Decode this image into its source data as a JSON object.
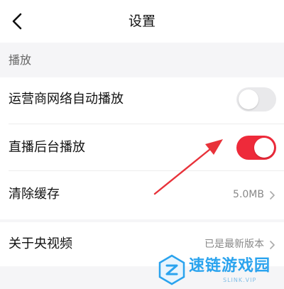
{
  "header": {
    "title": "设置",
    "back_icon": "chevron-left-icon"
  },
  "section": {
    "label": "播放"
  },
  "settings": {
    "carrier_autoplay": {
      "label": "运营商网络自动播放",
      "enabled": false
    },
    "live_background": {
      "label": "直播后台播放",
      "enabled": true
    },
    "clear_cache": {
      "label": "清除缓存",
      "value": "5.0MB"
    },
    "about": {
      "label": "关于央视频",
      "value": "已是最新版本"
    }
  },
  "colors": {
    "accent": "#ee2a3a",
    "toggle_off": "#e9e9eb",
    "annotation_arrow": "#e8323a"
  },
  "watermark": {
    "text": "速链游戏园",
    "sub": "SLINK.VIP"
  }
}
